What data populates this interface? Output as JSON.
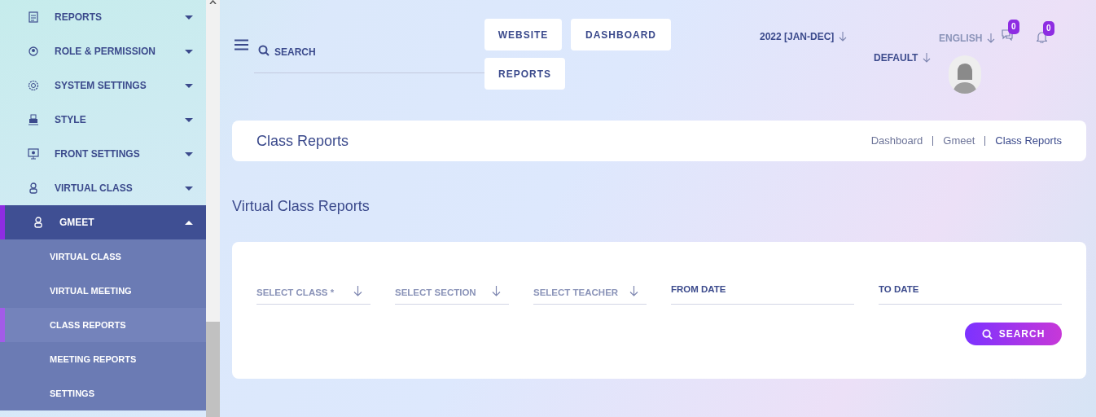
{
  "sidebar": {
    "items": [
      {
        "label": "REPORTS",
        "expanded": false
      },
      {
        "label": "ROLE & PERMISSION",
        "expanded": false
      },
      {
        "label": "SYSTEM SETTINGS",
        "expanded": false
      },
      {
        "label": "STYLE",
        "expanded": false
      },
      {
        "label": "FRONT SETTINGS",
        "expanded": false
      },
      {
        "label": "VIRTUAL CLASS",
        "expanded": false
      },
      {
        "label": "GMEET",
        "expanded": true,
        "children": [
          {
            "label": "VIRTUAL CLASS",
            "selected": false
          },
          {
            "label": "VIRTUAL MEETING",
            "selected": false
          },
          {
            "label": "CLASS REPORTS",
            "selected": true
          },
          {
            "label": "MEETING REPORTS",
            "selected": false
          },
          {
            "label": "SETTINGS",
            "selected": false
          }
        ]
      }
    ]
  },
  "topbar": {
    "search": {
      "placeholder": "SEARCH"
    },
    "buttons": [
      "WEBSITE",
      "DASHBOARD",
      "REPORTS"
    ],
    "academic_year": "2022 [JAN-DEC]",
    "language": "ENGLISH",
    "theme": "DEFAULT",
    "message_count": "0",
    "notification_count": "0"
  },
  "header": {
    "title": "Class Reports",
    "breadcrumb": [
      "Dashboard",
      "Gmeet",
      "Class Reports"
    ]
  },
  "section_title": "Virtual Class Reports",
  "form": {
    "fields": [
      {
        "kind": "select",
        "label": "SELECT CLASS *"
      },
      {
        "kind": "select",
        "label": "SELECT SECTION"
      },
      {
        "kind": "select",
        "label": "SELECT TEACHER"
      },
      {
        "kind": "date",
        "label": "FROM DATE"
      },
      {
        "kind": "date",
        "label": "TO DATE"
      }
    ],
    "search_button": "SEARCH"
  }
}
